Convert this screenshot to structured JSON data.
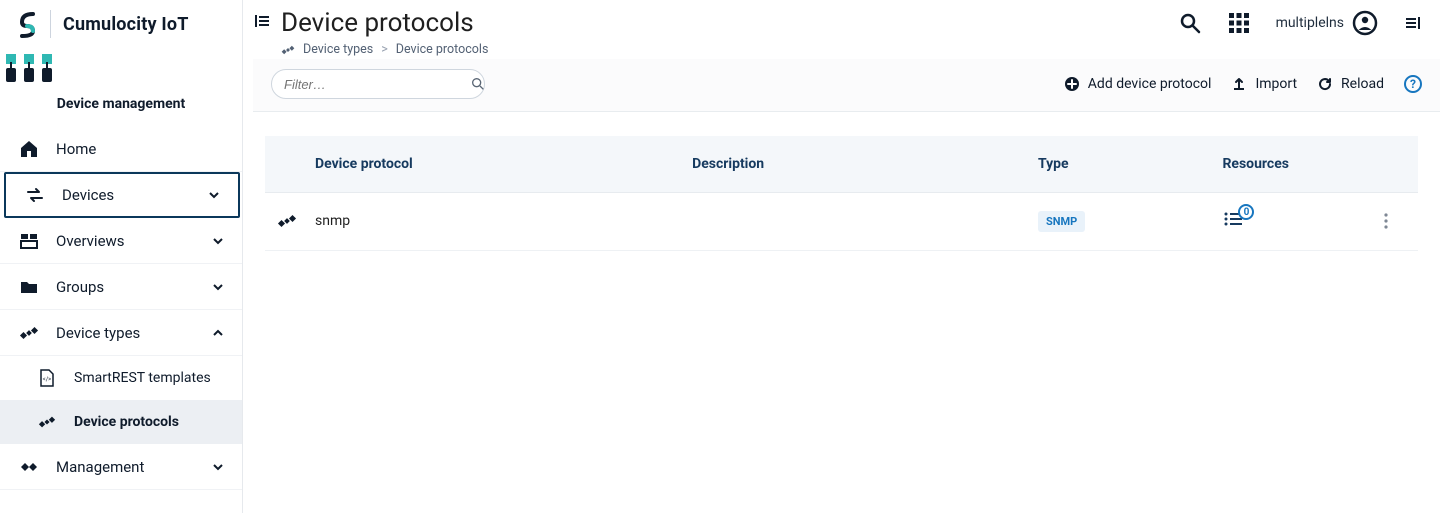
{
  "brand": {
    "name": "Cumulocity IoT"
  },
  "app": {
    "name": "Device management"
  },
  "sidebar": {
    "items": [
      {
        "label": "Home"
      },
      {
        "label": "Devices"
      },
      {
        "label": "Overviews"
      },
      {
        "label": "Groups"
      },
      {
        "label": "Device types"
      },
      {
        "label": "Management"
      }
    ],
    "device_types_children": [
      {
        "label": "SmartREST templates"
      },
      {
        "label": "Device protocols"
      }
    ]
  },
  "header": {
    "title": "Device protocols",
    "breadcrumb": {
      "root": "Device types",
      "current": "Device protocols"
    },
    "user": "multiplelns"
  },
  "actionbar": {
    "filter_placeholder": "Filter…",
    "add_label": "Add device protocol",
    "import_label": "Import",
    "reload_label": "Reload"
  },
  "table": {
    "columns": {
      "protocol": "Device protocol",
      "description": "Description",
      "type": "Type",
      "resources": "Resources"
    },
    "rows": [
      {
        "name": "snmp",
        "description": "",
        "type": "SNMP",
        "resources_count": "0"
      }
    ]
  }
}
